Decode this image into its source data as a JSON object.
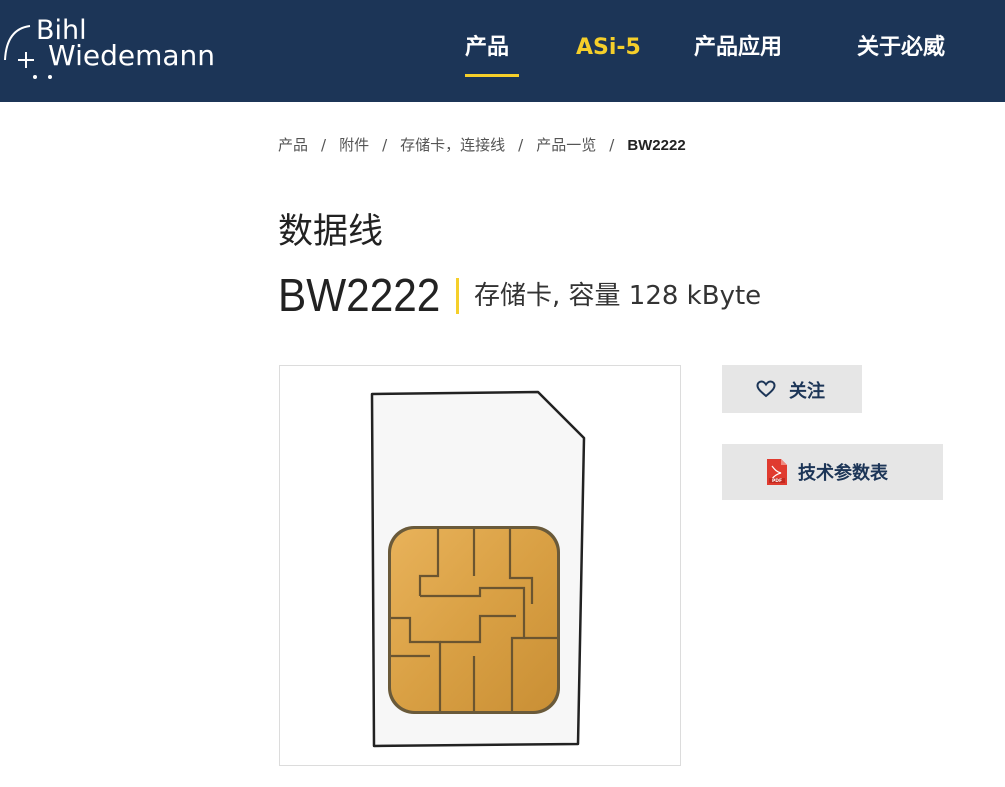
{
  "header": {
    "logo": {
      "line1": "Bihl",
      "line2": "Wiedemann"
    },
    "nav": [
      {
        "label": "产品"
      },
      {
        "label": "ASi-5"
      },
      {
        "label": "产品应用"
      },
      {
        "label": "关于必威"
      }
    ],
    "colors": {
      "background": "#1c3557",
      "accent": "#f5cf2a",
      "text": "#ffffff"
    }
  },
  "breadcrumb": {
    "items": [
      "产品",
      "附件",
      "存储卡，连接线",
      "产品一览"
    ],
    "separator": "/",
    "current": "BW2222"
  },
  "product": {
    "category": "数据线",
    "model": "BW2222",
    "description": "存储卡, 容量 128 kByte",
    "image_icon": "sim-memory-card-image"
  },
  "actions": {
    "follow_label": "关注",
    "follow_icon": "heart-icon",
    "datasheet_label": "技术参数表",
    "datasheet_icon": "pdf-icon"
  }
}
